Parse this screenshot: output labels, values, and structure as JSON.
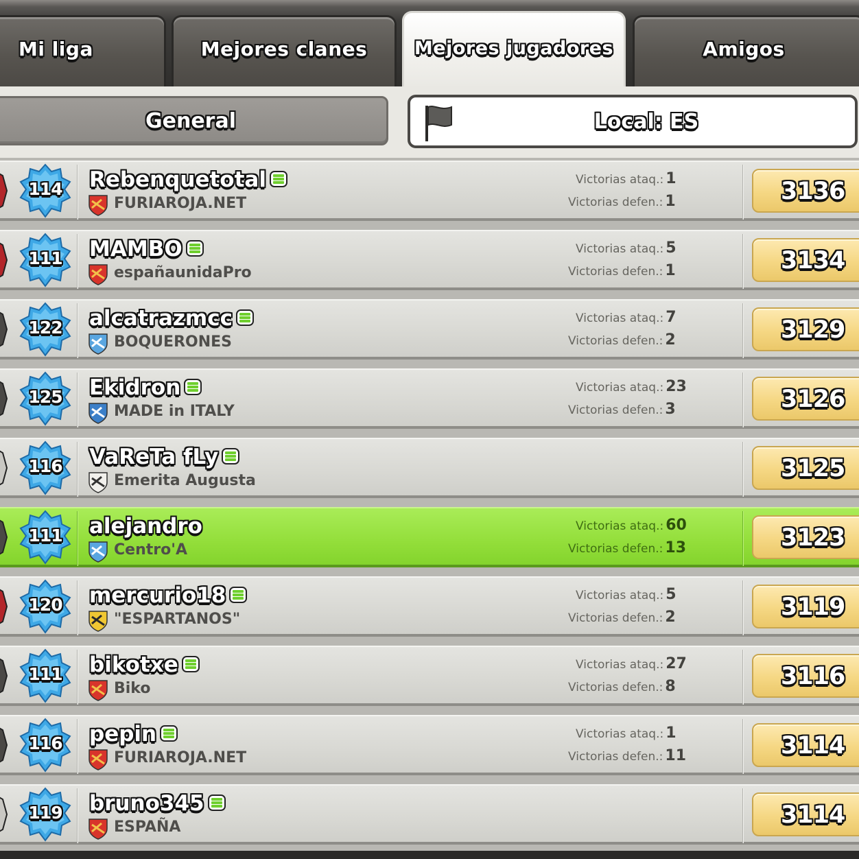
{
  "tabs": [
    {
      "label": "Mi liga",
      "active": false
    },
    {
      "label": "Mejores clanes",
      "active": false
    },
    {
      "label": "Mejores jugadores",
      "active": true
    },
    {
      "label": "Amigos",
      "active": false
    }
  ],
  "filters": {
    "general_label": "General",
    "local_label": "Local: ES",
    "local_icon": "flag-icon"
  },
  "stat_labels": {
    "attack": "Victorias ataq.:",
    "defense": "Victorias defen.:"
  },
  "players": [
    {
      "level": "114",
      "name": "Rebenquetotal",
      "online": true,
      "clan": "FURIAROJA.NET",
      "clan_badge": "red-shield",
      "attack_wins": "1",
      "defense_wins": "1",
      "trophies": "3136",
      "league": "red"
    },
    {
      "level": "111",
      "name": "MAMBO",
      "online": true,
      "clan": "españaunidaPro",
      "clan_badge": "red-shield",
      "attack_wins": "5",
      "defense_wins": "1",
      "trophies": "3134",
      "league": "red"
    },
    {
      "level": "122",
      "name": "alcatrazmcc",
      "online": true,
      "clan": "BOQUERONES",
      "clan_badge": "blue-shield",
      "attack_wins": "7",
      "defense_wins": "2",
      "trophies": "3129",
      "league": "dark"
    },
    {
      "level": "125",
      "name": "Ekidron",
      "online": true,
      "clan": "MADE in ITALY",
      "clan_badge": "blue-white-shield",
      "attack_wins": "23",
      "defense_wins": "3",
      "trophies": "3126",
      "league": "dark"
    },
    {
      "level": "116",
      "name": "VaReTa fLy",
      "online": true,
      "clan": "Emerita Augusta",
      "clan_badge": "white-shield",
      "attack_wins": "",
      "defense_wins": "",
      "trophies": "3125",
      "league": "light"
    },
    {
      "level": "111",
      "name": "alejandro",
      "online": false,
      "clan": "Centro'A",
      "clan_badge": "blue-shield",
      "attack_wins": "60",
      "defense_wins": "13",
      "trophies": "3123",
      "league": "dark",
      "highlight": true
    },
    {
      "level": "120",
      "name": "mercurio18",
      "online": true,
      "clan": "\"ESPARTANOS\"",
      "clan_badge": "yellow-shield",
      "attack_wins": "5",
      "defense_wins": "2",
      "trophies": "3119",
      "league": "red"
    },
    {
      "level": "111",
      "name": "bikotxe",
      "online": true,
      "clan": "Biko",
      "clan_badge": "red-yellow-shield",
      "attack_wins": "27",
      "defense_wins": "8",
      "trophies": "3116",
      "league": "dark"
    },
    {
      "level": "116",
      "name": "pepin",
      "online": true,
      "clan": "FURIAROJA.NET",
      "clan_badge": "red-shield",
      "attack_wins": "1",
      "defense_wins": "11",
      "trophies": "3114",
      "league": "dark"
    },
    {
      "level": "119",
      "name": "bruno345",
      "online": true,
      "clan": "ESPAÑA",
      "clan_badge": "red-shield",
      "attack_wins": "",
      "defense_wins": "",
      "trophies": "3114",
      "league": "light"
    }
  ],
  "colors": {
    "highlight_row": "#93de3a",
    "level_badge": "#3ea8e6",
    "trophy_box": "#f5d783",
    "online_indicator": "#6fcf2e"
  }
}
